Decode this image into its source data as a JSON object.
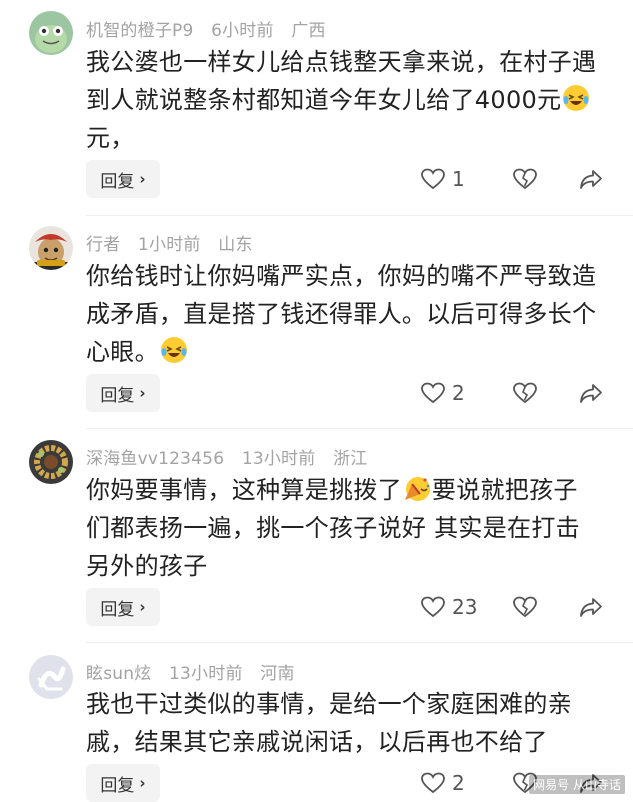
{
  "comments": [
    {
      "username": "机智的橙子P9",
      "time": "6小时前",
      "location": "广西",
      "text_line1": "我公婆也一样女儿给点钱整天拿来说，在村子遇",
      "text_line2a": "到人就说整条村都知道今年女儿给了4000元",
      "text_line3": "元，",
      "reply_label": "回复",
      "likes": "1"
    },
    {
      "username": "行者",
      "time": "1小时前",
      "location": "山东",
      "text_line1": "你给钱时让你妈嘴严实点，你妈的嘴不严导致造",
      "text_line2": "成矛盾，直是搭了钱还得罪人。以后可得多长个",
      "text_line3": "心眼。",
      "reply_label": "回复",
      "likes": "2"
    },
    {
      "username": "深海鱼vv123456",
      "time": "13小时前",
      "location": "浙江",
      "text_line1a": "你妈要事情，这种算是挑拨了",
      "text_line1b": "要说就把孩子",
      "text_line2": "们都表扬一遍，挑一个孩子说好 其实是在打击",
      "text_line3": "另外的孩子",
      "reply_label": "回复",
      "likes": "23"
    },
    {
      "username": "眩sun炫",
      "time": "13小时前",
      "location": "河南",
      "text_line1": "我也干过类似的事情，是给一个家庭困难的亲",
      "text_line2": "戚，结果其它亲戚说闲话，以后再也不给了",
      "reply_label": "回复",
      "likes": "2"
    }
  ],
  "watermark": "网易号 从山寺话",
  "icons": [
    "heart-outline-icon",
    "broken-heart-icon",
    "share-arrow-icon",
    "chevron-right-icon"
  ],
  "colors": {
    "meta_text": "#a3a3a3",
    "body_text": "#222222",
    "reply_bg": "#f3f3f3"
  }
}
